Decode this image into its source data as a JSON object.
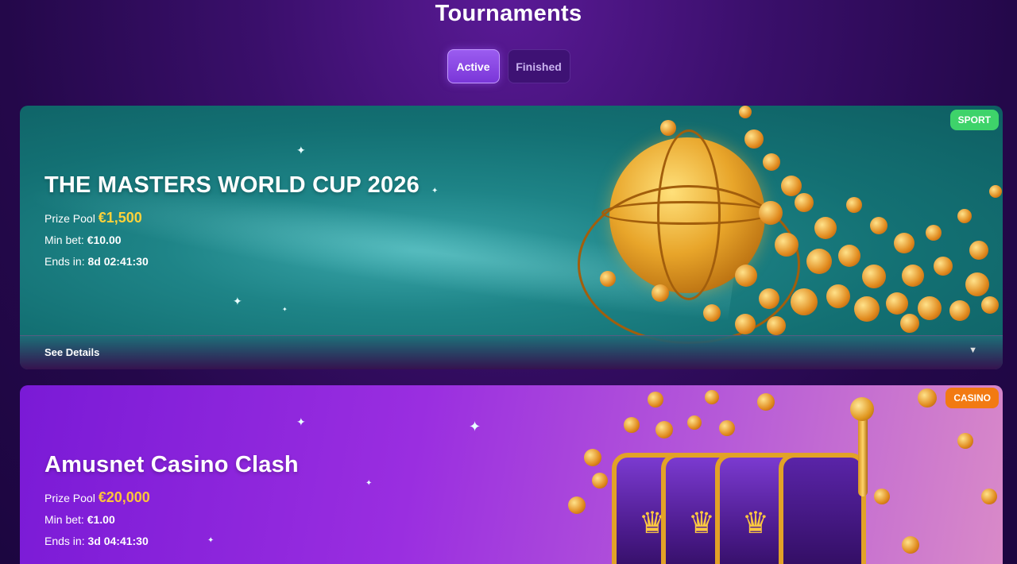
{
  "page": {
    "title": "Tournaments"
  },
  "tabs": [
    {
      "label": "Active",
      "active": true
    },
    {
      "label": "Finished",
      "active": false
    }
  ],
  "tournaments": [
    {
      "badge": "SPORT",
      "title": "THE MASTERS WORLD CUP 2026",
      "prize_label": "Prize Pool",
      "prize_value": "€1,500",
      "min_bet_label": "Min bet:",
      "min_bet_value": "€10.00",
      "ends_label": "Ends in:",
      "ends_value": "8d 02:41:30",
      "details_label": "See Details",
      "artwork": "golden-basketball-coins"
    },
    {
      "badge": "CASINO",
      "title": "Amusnet Casino Clash",
      "prize_label": "Prize Pool",
      "prize_value": "€20,000",
      "min_bet_label": "Min bet:",
      "min_bet_value": "€1.00",
      "ends_label": "Ends in:",
      "ends_value": "3d 04:41:30",
      "artwork": "slot-machine-crowns-coins"
    }
  ],
  "colors": {
    "sport_badge": "#3ed36a",
    "casino_badge": "#f27a12",
    "prize_value": "#ffd23a",
    "tab_active": "#8a46e4"
  }
}
